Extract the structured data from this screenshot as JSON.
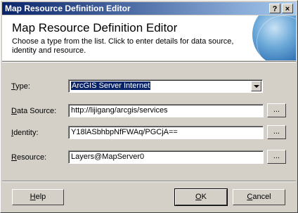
{
  "window": {
    "title": "Map Resource Definition Editor",
    "help_glyph": "?",
    "close_glyph": "×"
  },
  "header": {
    "title": "Map Resource Definition Editor",
    "subtitle": "Choose a type from the list. Click to enter details for data source, identity and resource."
  },
  "form": {
    "type": {
      "label_accel": "T",
      "label_rest": "ype:",
      "value": "ArcGIS Server Internet"
    },
    "data_source": {
      "label_accel": "D",
      "label_rest": "ata Source:",
      "value": "http://lijigang/arcgis/services",
      "browse": "..."
    },
    "identity": {
      "label_accel": "I",
      "label_rest": "dentity:",
      "value": "Y18lASbhbpNfFWAq/PGCjA==",
      "browse": "..."
    },
    "resource": {
      "label_accel": "R",
      "label_rest": "esource:",
      "value": "Layers@MapServer0",
      "browse": "..."
    }
  },
  "buttons": {
    "help_accel": "H",
    "help_rest": "elp",
    "ok_accel": "O",
    "ok_rest": "K",
    "cancel_accel": "C",
    "cancel_rest": "ancel"
  },
  "colors": {
    "title_bar_start": "#0a246a",
    "title_bar_end": "#a6caf0",
    "dialog_face": "#d4d0c8",
    "selection": "#0a246a"
  }
}
